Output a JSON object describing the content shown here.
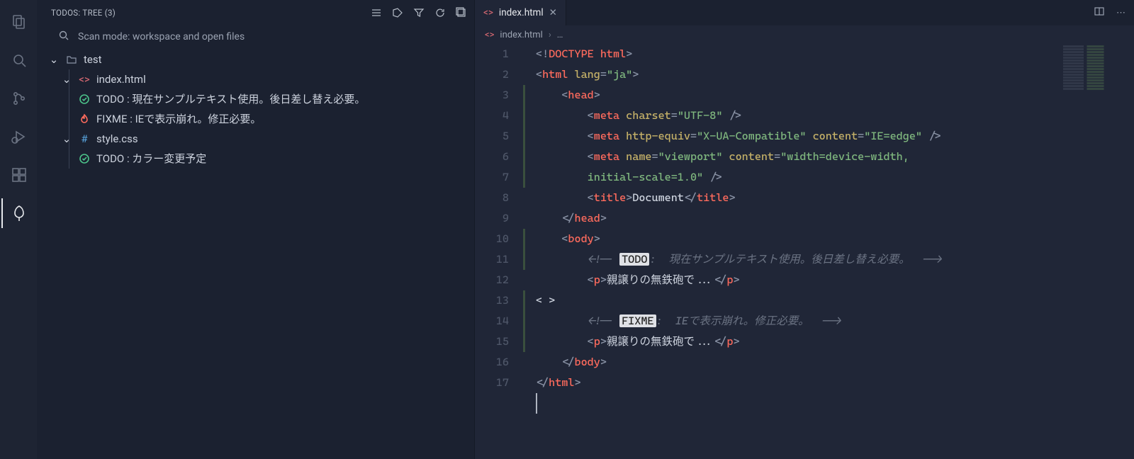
{
  "activity": {
    "items": [
      "explorer",
      "search",
      "scm",
      "debug",
      "extensions",
      "todo-tree"
    ],
    "active": "todo-tree"
  },
  "sidebar": {
    "title": "TODOS: TREE (3)",
    "scan_label": "Scan mode: workspace and open files",
    "root": {
      "label": "test"
    },
    "files": [
      {
        "label": "index.html",
        "type": "html",
        "items": [
          {
            "kind": "todo",
            "text": "TODO : 現在サンプルテキスト使用。後日差し替え必要。"
          },
          {
            "kind": "fixme",
            "text": "FIXME : IEで表示崩れ。修正必要。"
          }
        ]
      },
      {
        "label": "style.css",
        "type": "css",
        "items": [
          {
            "kind": "todo",
            "text": "TODO : カラー変更予定"
          }
        ]
      }
    ]
  },
  "editor": {
    "tab": {
      "label": "index.html"
    },
    "breadcrumb": {
      "file": "index.html",
      "rest": "…"
    },
    "line_numbers": [
      "1",
      "2",
      "3",
      "4",
      "5",
      "6",
      "7",
      "8",
      "9",
      "10",
      "11",
      "12",
      "13",
      "14",
      "15",
      "16",
      "17"
    ],
    "git_modified_lines": [
      3,
      4,
      5,
      6,
      7,
      10,
      11,
      13,
      14,
      15
    ],
    "code": {
      "doctype": "DOCTYPE html",
      "html_lang_attr": "lang",
      "html_lang_val": "\"ja\"",
      "head_open": "head",
      "meta_charset_attr": "charset",
      "meta_charset_val": "\"UTF-8\"",
      "meta_httpequiv_attr": "http-equiv",
      "meta_httpequiv_val": "\"X-UA-Compatible\"",
      "meta_content_attr": "content",
      "meta_content_val": "\"IE=edge\"",
      "meta_name_attr": "name",
      "meta_name_val": "\"viewport\"",
      "meta_vp_content_val": "\"width=device-width, ",
      "meta_vp_content_wrap": "initial-scale=1.0\"",
      "title_tag": "title",
      "title_text": "Document",
      "body_tag": "body",
      "todo_marker": "TODO",
      "todo_comment_text": ":  現在サンプルテキスト使用。後日差し替え必要。  ",
      "fixme_marker": "FIXME",
      "fixme_comment_text": ":  IEで表示崩れ。修正必要。  ",
      "p_text": "親譲りの無鉄砲で...",
      "p_tag": "p",
      "meta_tag": "meta",
      "html_tag": "html",
      "slash_close": " />",
      "comment_open": "<!-- ",
      "comment_close": "-->"
    }
  }
}
